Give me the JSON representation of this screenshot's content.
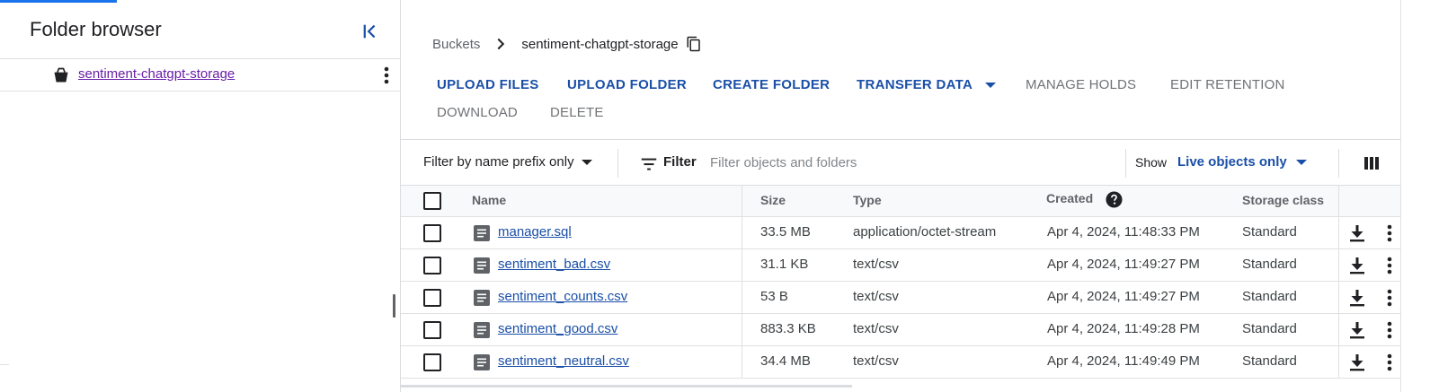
{
  "left_panel": {
    "title": "Folder browser",
    "tree_items": [
      {
        "label": "sentiment-chatgpt-storage"
      }
    ]
  },
  "breadcrumb": {
    "root": "Buckets",
    "current": "sentiment-chatgpt-storage"
  },
  "toolbar": {
    "upload_files": "UPLOAD FILES",
    "upload_folder": "UPLOAD FOLDER",
    "create_folder": "CREATE FOLDER",
    "transfer_data": "TRANSFER DATA",
    "manage_holds": "MANAGE HOLDS",
    "edit_retention": "EDIT RETENTION",
    "download": "DOWNLOAD",
    "delete": "DELETE"
  },
  "filter_bar": {
    "prefix_mode": "Filter by name prefix only",
    "filter_label": "Filter",
    "placeholder": "Filter objects and folders",
    "show_label": "Show",
    "show_value": "Live objects only"
  },
  "table": {
    "columns": {
      "name": "Name",
      "size": "Size",
      "type": "Type",
      "created": "Created",
      "storage_class": "Storage class"
    },
    "rows": [
      {
        "name": "manager.sql",
        "size": "33.5 MB",
        "type": "application/octet-stream",
        "created": "Apr 4, 2024, 11:48:33 PM",
        "storage_class": "Standard"
      },
      {
        "name": "sentiment_bad.csv",
        "size": "31.1 KB",
        "type": "text/csv",
        "created": "Apr 4, 2024, 11:49:27 PM",
        "storage_class": "Standard"
      },
      {
        "name": "sentiment_counts.csv",
        "size": "53 B",
        "type": "text/csv",
        "created": "Apr 4, 2024, 11:49:27 PM",
        "storage_class": "Standard"
      },
      {
        "name": "sentiment_good.csv",
        "size": "883.3 KB",
        "type": "text/csv",
        "created": "Apr 4, 2024, 11:49:28 PM",
        "storage_class": "Standard"
      },
      {
        "name": "sentiment_neutral.csv",
        "size": "34.4 MB",
        "type": "text/csv",
        "created": "Apr 4, 2024, 11:49:49 PM",
        "storage_class": "Standard"
      }
    ]
  },
  "colors": {
    "link_blue": "#1a4fa8",
    "visited_purple": "#681da8",
    "accent": "#1a73e8"
  }
}
